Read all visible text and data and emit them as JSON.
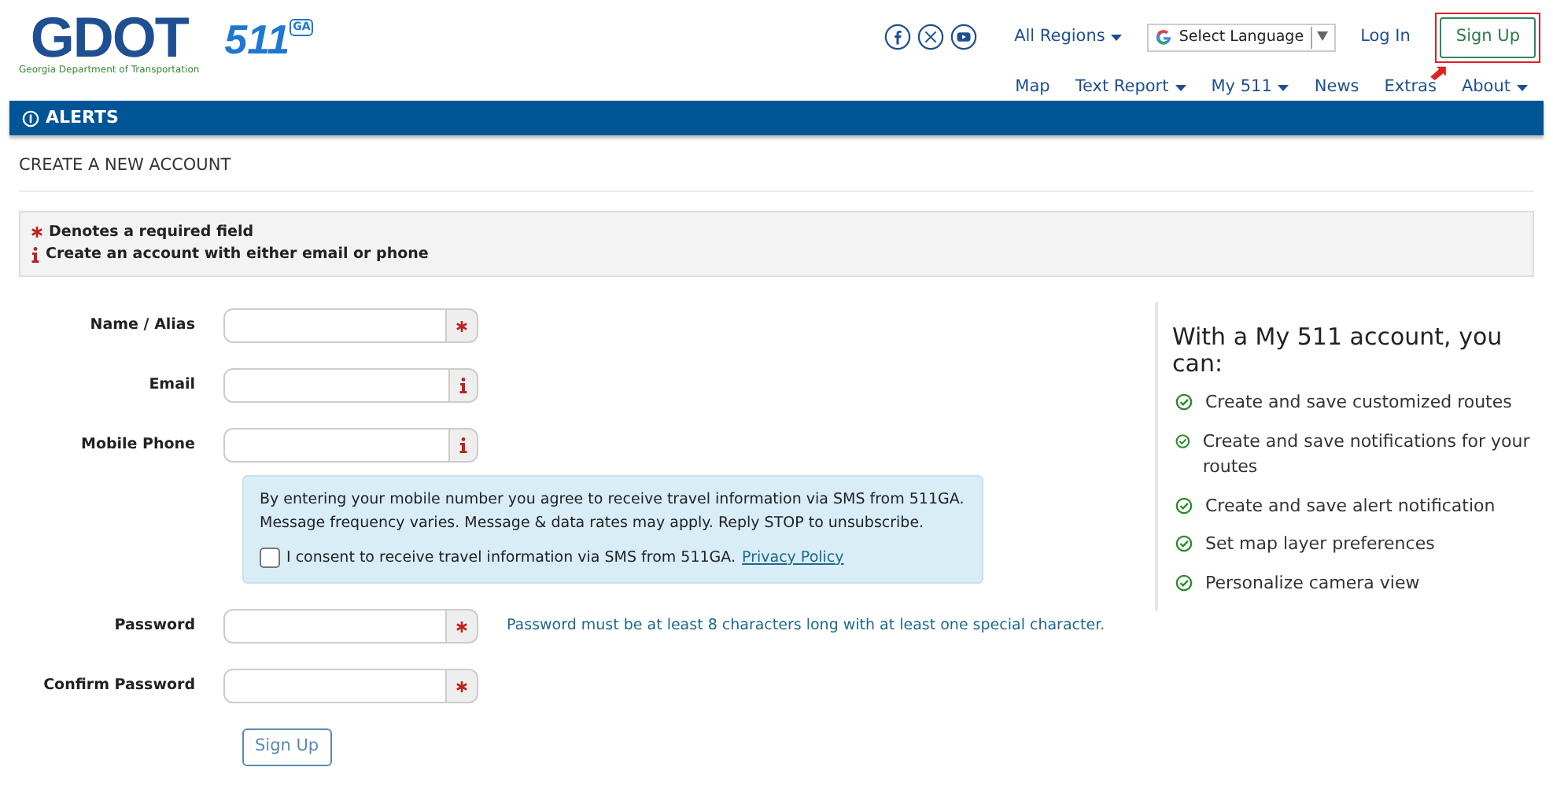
{
  "logo": {
    "wordmark": "GDOT",
    "tagline": "Georgia Department of Transportation",
    "badge": "511",
    "badge_state": "GA"
  },
  "header": {
    "region_menu": "All Regions",
    "language": "Select Language",
    "login": "Log In",
    "signup": {
      "label": "Sign Up",
      "highlighted": true
    }
  },
  "nav": [
    {
      "label": "Map",
      "dropdown": false
    },
    {
      "label": "Text Report",
      "dropdown": true
    },
    {
      "label": "My 511",
      "dropdown": true
    },
    {
      "label": "News",
      "dropdown": false
    },
    {
      "label": "Extras",
      "dropdown": false
    },
    {
      "label": "About",
      "dropdown": true
    }
  ],
  "alerts_bar": "ALERTS",
  "page_title": "CREATE A NEW ACCOUNT",
  "legend": [
    {
      "kind": "required",
      "text": "Denotes a required field"
    },
    {
      "kind": "info",
      "text": "Create an account with either email or phone"
    }
  ],
  "fields": [
    {
      "label": "Name / Alias",
      "kind": "required"
    },
    {
      "label": "Email",
      "kind": "info"
    },
    {
      "label": "Mobile Phone",
      "kind": "info"
    },
    {
      "label": "Password",
      "kind": "required",
      "hint": "Password must be at least 8 characters long with at least one special character."
    },
    {
      "label": "Confirm Password",
      "kind": "required"
    }
  ],
  "sms_notice": {
    "text": "By entering your mobile number you agree to receive travel information via SMS from 511GA. Message frequency varies. Message & data rates may apply. Reply STOP to unsubscribe.",
    "consent": "I consent to receive travel information via SMS from 511GA.",
    "consent_checked": false,
    "link": "Privacy Policy"
  },
  "submit": "Sign Up",
  "benefits": {
    "title": "With a My 511 account, you can:",
    "items": [
      "Create and save customized routes",
      "Create and save notifications for your routes",
      "Create and save alert notification",
      "Set map layer preferences",
      "Personalize camera view"
    ]
  }
}
